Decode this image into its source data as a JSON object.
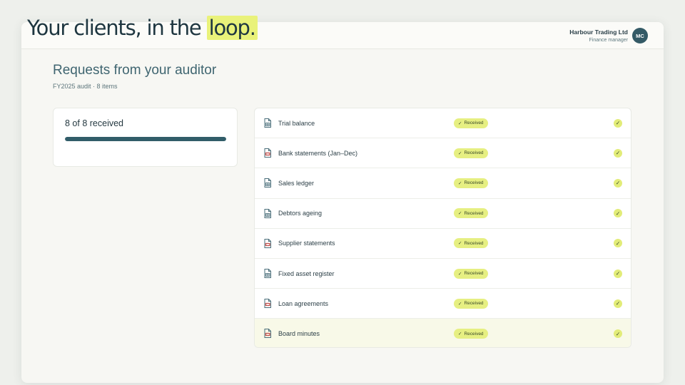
{
  "headline": {
    "prefix": "Your clients, in the ",
    "highlight": "loop."
  },
  "header": {
    "org_name": "Harbour Trading Ltd",
    "org_role": "Finance manager",
    "avatar_initials": "MC"
  },
  "page": {
    "title": "Requests from your auditor",
    "subtitle": "FY2025 audit · 8 items"
  },
  "progress": {
    "text": "8 of 8 received",
    "received": 8,
    "total": 8
  },
  "requests": [
    {
      "label": "Trial balance",
      "status": "Received",
      "icon": "spreadsheet-doc-icon"
    },
    {
      "label": "Bank statements (Jan–Dec)",
      "status": "Received",
      "icon": "pdf-doc-icon"
    },
    {
      "label": "Sales ledger",
      "status": "Received",
      "icon": "spreadsheet-doc-icon"
    },
    {
      "label": "Debtors ageing",
      "status": "Received",
      "icon": "spreadsheet-doc-icon"
    },
    {
      "label": "Supplier statements",
      "status": "Received",
      "icon": "pdf-doc-icon"
    },
    {
      "label": "Fixed asset register",
      "status": "Received",
      "icon": "spreadsheet-doc-icon"
    },
    {
      "label": "Loan agreements",
      "status": "Received",
      "icon": "pdf-doc-icon"
    },
    {
      "label": "Board minutes",
      "status": "Received",
      "icon": "pdf-doc-icon"
    }
  ],
  "colors": {
    "accent": "#e6ef82",
    "primary": "#315d69",
    "pdf_icon": "#c0504d",
    "sheet_icon": "#4a6e7a"
  }
}
